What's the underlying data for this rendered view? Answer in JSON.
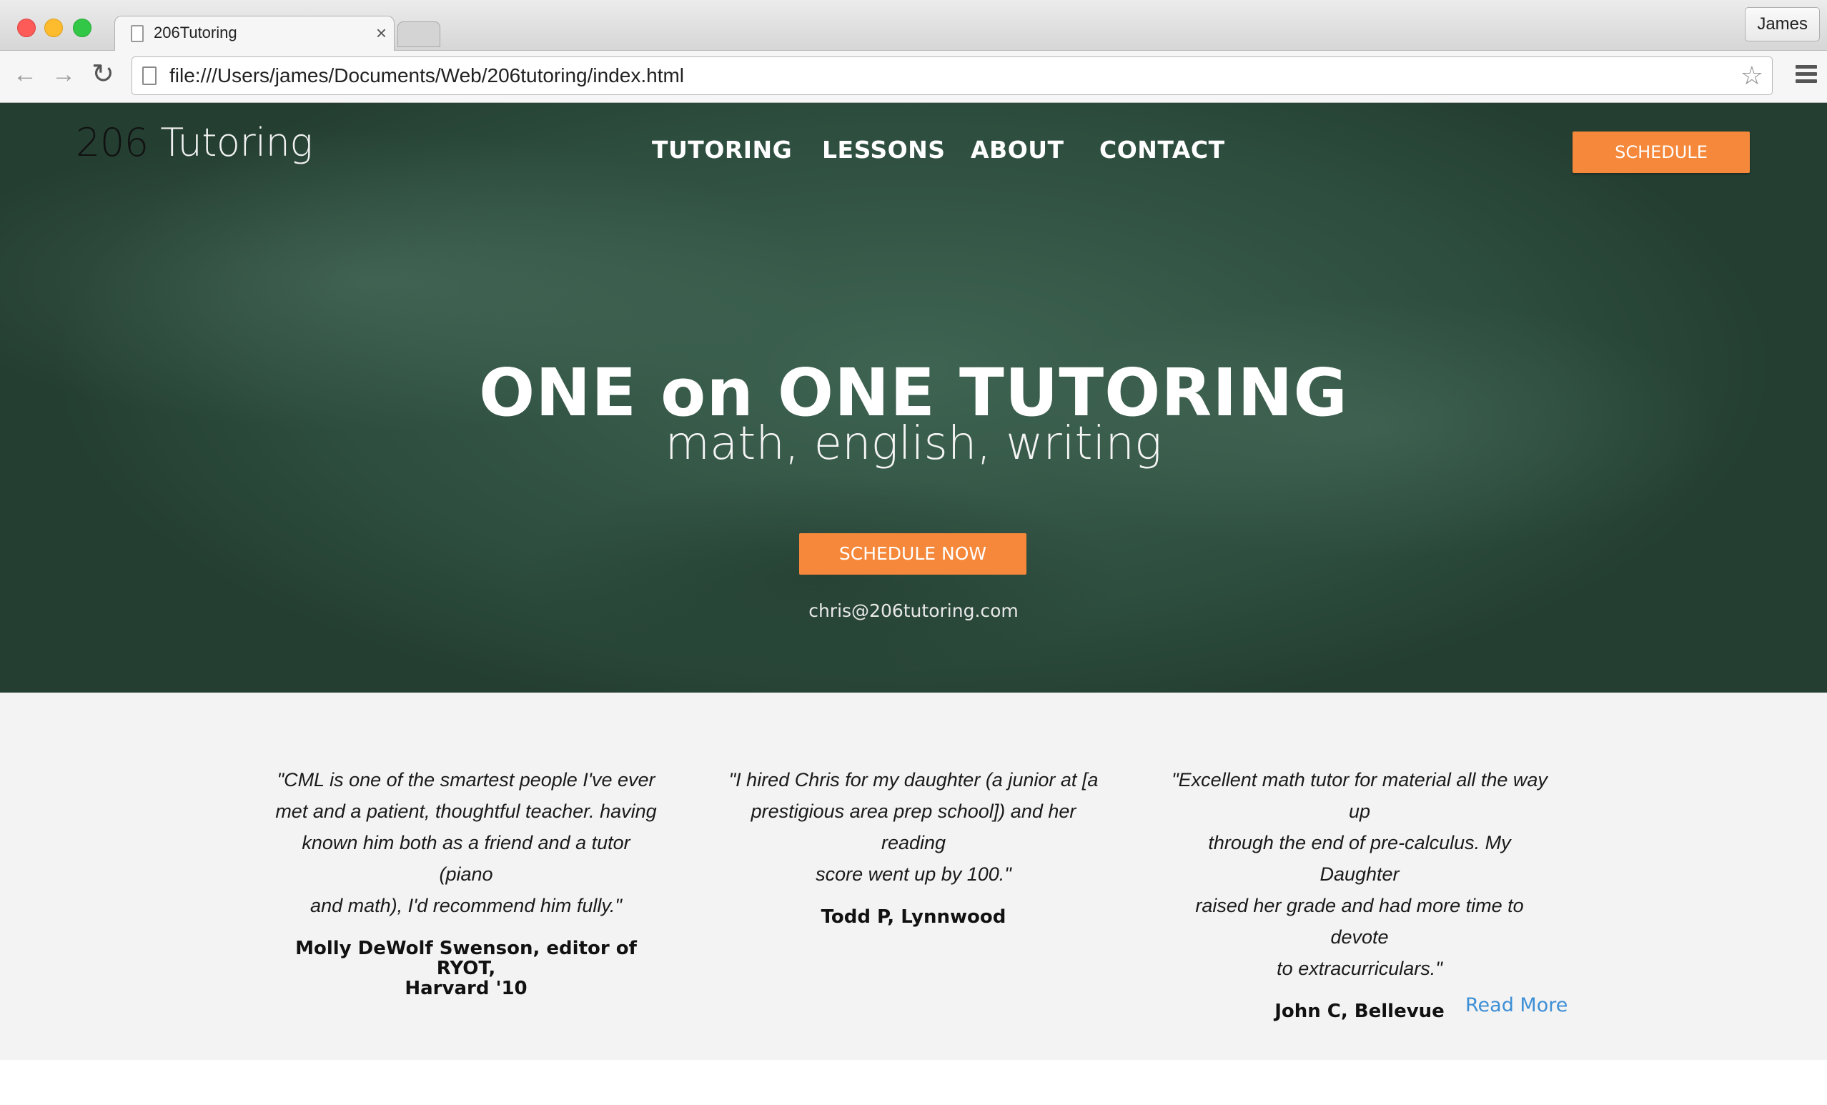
{
  "browser": {
    "tab_title": "206Tutoring",
    "tab_close": "×",
    "profile_name": "James",
    "url": "file:///Users/james/Documents/Web/206tutoring/index.html",
    "back_glyph": "←",
    "forward_glyph": "→",
    "reload_glyph": "↻",
    "bookmark_glyph": "☆",
    "icons": [
      "page-icon",
      "back-icon",
      "forward-icon",
      "reload-icon",
      "star-icon",
      "menu-icon"
    ]
  },
  "site": {
    "logo_number": "206",
    "logo_word": "Tutoring",
    "nav": [
      "TUTORING",
      "LESSONS",
      "ABOUT",
      "CONTACT"
    ],
    "schedule_button": "SCHEDULE",
    "hero_title": "ONE on ONE TUTORING",
    "hero_subtitle": "math, english, writing",
    "cta_button": "SCHEDULE NOW",
    "email": "chris@206tutoring.com",
    "accent_color": "#f5883a",
    "link_color": "#3d8fd6"
  },
  "testimonials": [
    {
      "quote_lines": [
        "\"CML is one of the smartest people I've ever",
        "met and a patient, thoughtful teacher. having",
        "known him both as a friend and a tutor (piano",
        "and math), I'd recommend him fully.\""
      ],
      "author_lines": [
        "Molly DeWolf Swenson, editor of RYOT,",
        "Harvard '10"
      ]
    },
    {
      "quote_lines": [
        "\"I hired Chris for my daughter (a junior at [a",
        "prestigious area prep school]) and her reading",
        "score went up by 100.\""
      ],
      "author_lines": [
        "Todd P, Lynnwood"
      ]
    },
    {
      "quote_lines": [
        "\"Excellent math tutor for material all the way up",
        "through the end of pre-calculus. My Daughter",
        "raised her grade and had more time to devote",
        "to extracurriculars.\""
      ],
      "author_lines": [
        "John C, Bellevue"
      ]
    }
  ],
  "read_more": "Read More"
}
